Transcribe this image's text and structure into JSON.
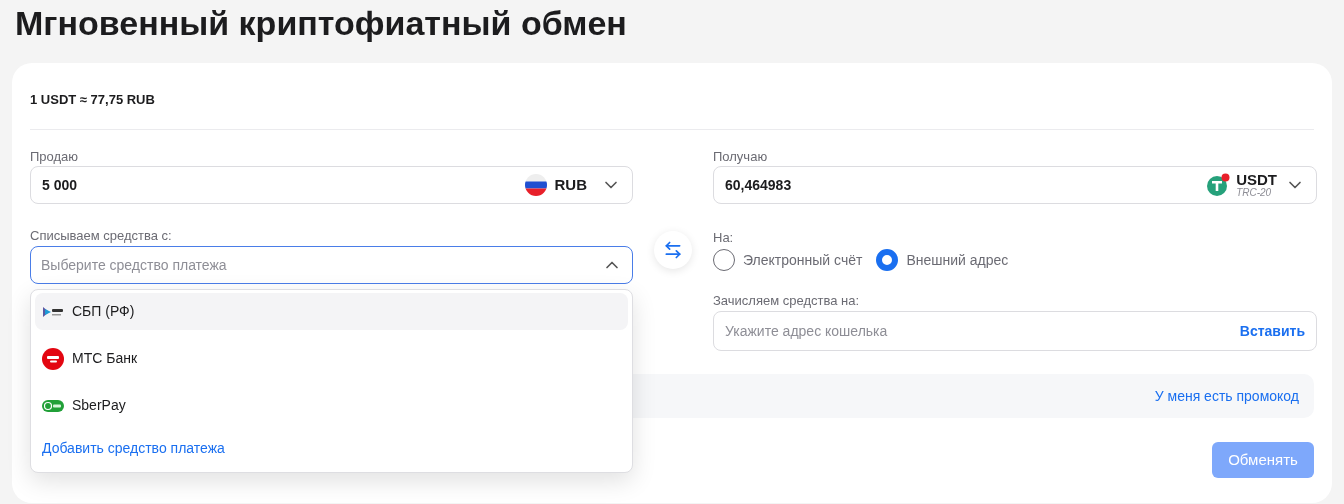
{
  "page_title": "Мгновенный криптофиатный обмен",
  "rate": "1 USDT ≈ 77,75 RUB",
  "sell": {
    "label": "Продаю",
    "value": "5 000",
    "currency": "RUB"
  },
  "debit": {
    "label": "Списываем средства с:",
    "placeholder": "Выберите средство платежа",
    "expanded": true,
    "options": [
      {
        "label": "СБП (РФ)",
        "kind": "sbp",
        "selected": true
      },
      {
        "label": "МТС Банк",
        "kind": "mts",
        "selected": false
      },
      {
        "label": "SberPay",
        "kind": "sberpay",
        "selected": false
      }
    ],
    "add_link": "Добавить средство платежа"
  },
  "receive": {
    "label": "Получаю",
    "value": "60,464983",
    "currency": "USDT",
    "network": "TRC-20"
  },
  "destination": {
    "label": "На:",
    "options": [
      {
        "label": "Электронный счёт",
        "selected": false
      },
      {
        "label": "Внешний адрес",
        "selected": true
      }
    ]
  },
  "credit": {
    "label": "Зачисляем средства на:",
    "placeholder": "Укажите адрес кошелька",
    "paste": "Вставить"
  },
  "promo_link": "У меня есть промокод",
  "submit": {
    "label": "Обменять",
    "disabled": true
  }
}
